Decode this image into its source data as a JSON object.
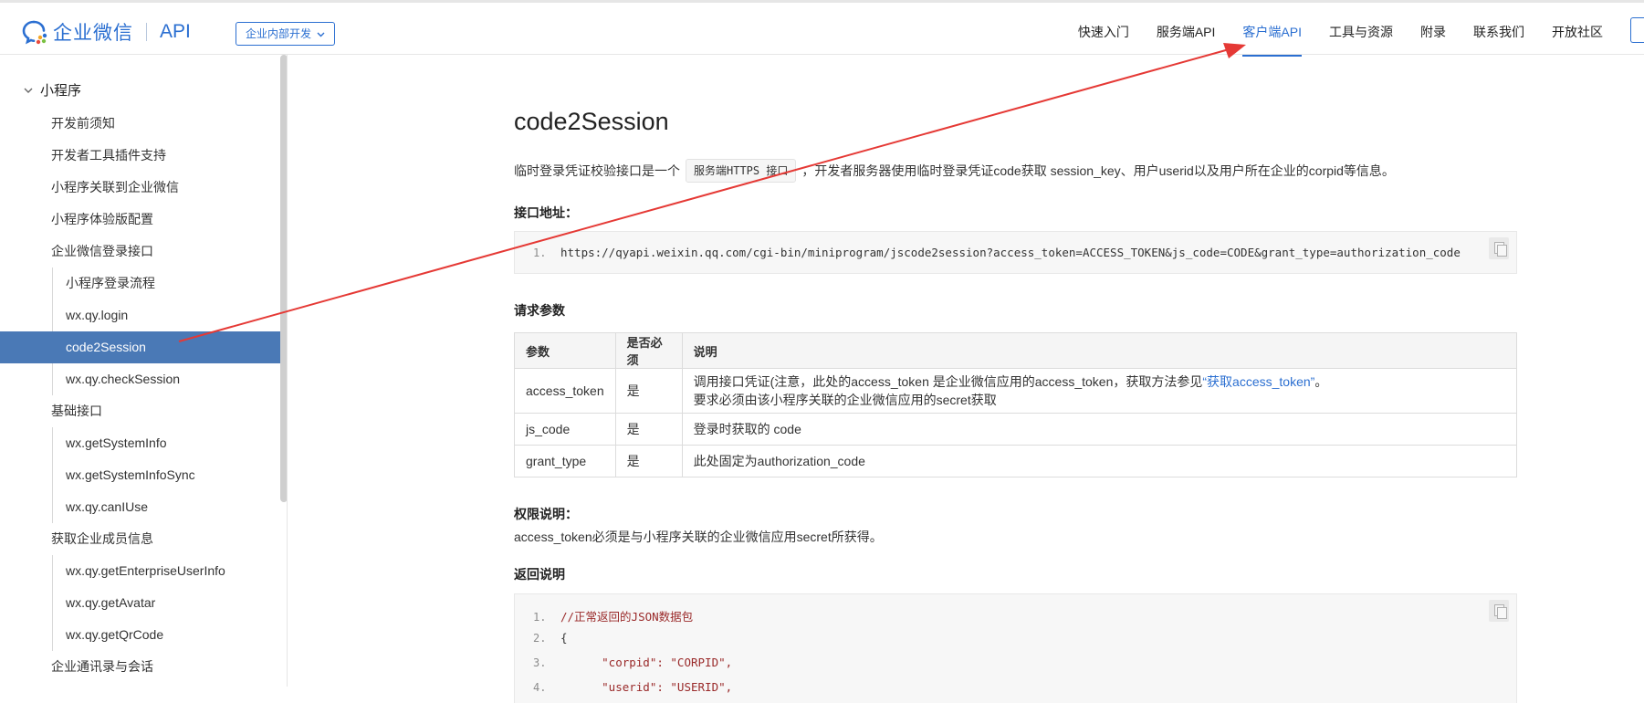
{
  "header": {
    "logo_text": "企业微信",
    "logo_api": "API",
    "badge": "企业内部开发",
    "nav": [
      "快速入门",
      "服务端API",
      "客户端API",
      "工具与资源",
      "附录",
      "联系我们",
      "开放社区"
    ],
    "active_nav_index": 2,
    "accent_color": "#2b6fd1"
  },
  "sidebar": {
    "root": "小程序",
    "items": [
      {
        "label": "开发前须知",
        "level": 1
      },
      {
        "label": "开发者工具插件支持",
        "level": 1
      },
      {
        "label": "小程序关联到企业微信",
        "level": 1
      },
      {
        "label": "小程序体验版配置",
        "level": 1
      },
      {
        "label": "企业微信登录接口",
        "level": 1
      },
      {
        "label": "小程序登录流程",
        "level": 2
      },
      {
        "label": "wx.qy.login",
        "level": 2
      },
      {
        "label": "code2Session",
        "level": 2,
        "active": true
      },
      {
        "label": "wx.qy.checkSession",
        "level": 2
      },
      {
        "label": "基础接口",
        "level": 1
      },
      {
        "label": "wx.getSystemInfo",
        "level": 2
      },
      {
        "label": "wx.getSystemInfoSync",
        "level": 2
      },
      {
        "label": "wx.qy.canIUse",
        "level": 2
      },
      {
        "label": "获取企业成员信息",
        "level": 1
      },
      {
        "label": "wx.qy.getEnterpriseUserInfo",
        "level": 2
      },
      {
        "label": "wx.qy.getAvatar",
        "level": 2
      },
      {
        "label": "wx.qy.getQrCode",
        "level": 2
      },
      {
        "label": "企业通讯录与会话",
        "level": 1
      }
    ],
    "active_color": "#4a79b6"
  },
  "content": {
    "title": "code2Session",
    "intro_before": "临时登录凭证校验接口是一个",
    "intro_tag": "服务端HTTPS 接口",
    "intro_after": "，开发者服务器使用临时登录凭证code获取 session_key、用户userid以及用户所在企业的corpid等信息。",
    "url_heading": "接口地址：",
    "url_line_no": "1.",
    "url": "https://qyapi.weixin.qq.com/cgi-bin/miniprogram/jscode2session?access_token=ACCESS_TOKEN&js_code=CODE&grant_type=authorization_code",
    "params_heading": "请求参数",
    "table": {
      "headers": [
        "参数",
        "是否必须",
        "说明"
      ],
      "rows": [
        {
          "param": "access_token",
          "required": "是",
          "desc_a": "调用接口凭证(注意，此处的access_token 是企业微信应用的access_token，获取方法参见",
          "desc_link": "“获取access_token”",
          "desc_b": "。",
          "desc_line2": "要求必须由该小程序关联的企业微信应用的secret获取"
        },
        {
          "param": "js_code",
          "required": "是",
          "desc_a": "登录时获取的 code"
        },
        {
          "param": "grant_type",
          "required": "是",
          "desc_a": "此处固定为authorization_code"
        }
      ]
    },
    "perm_heading": "权限说明：",
    "perm_text": "access_token必须是与小程序关联的企业微信应用secret所获得。",
    "return_heading": "返回说明",
    "return_code": [
      {
        "no": "1.",
        "text": "//正常返回的JSON数据包"
      },
      {
        "no": "2.",
        "text": "{"
      },
      {
        "no": "3.",
        "text": "      \"corpid\": \"CORPID\","
      },
      {
        "no": "4.",
        "text": "      \"userid\": \"USERID\","
      }
    ]
  },
  "annotation": {
    "arrow_color": "#e53935"
  }
}
